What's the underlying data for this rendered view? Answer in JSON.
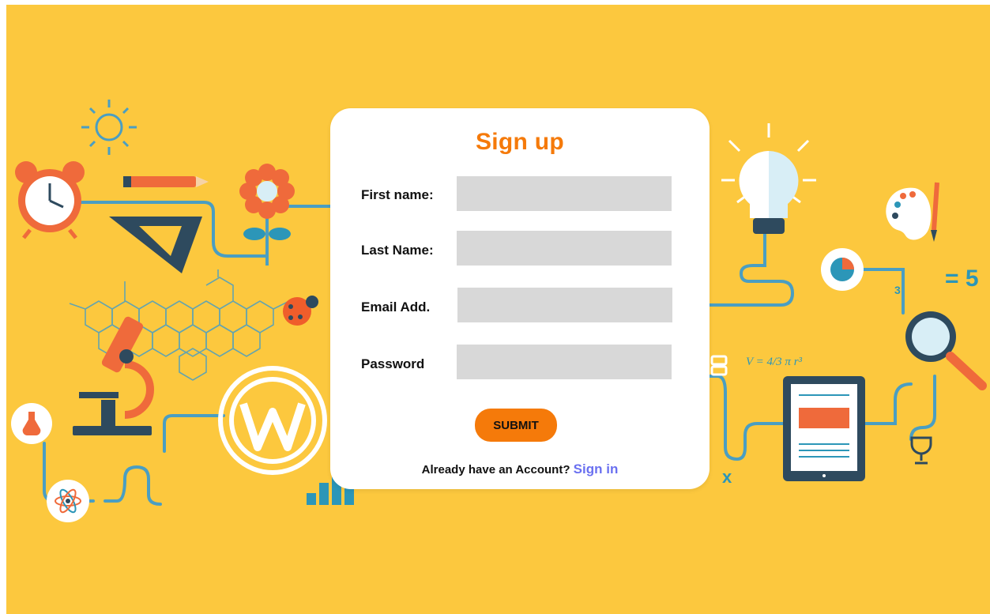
{
  "signup": {
    "title": "Sign up",
    "fields": [
      {
        "label": "First name:",
        "value": "",
        "placeholder": ""
      },
      {
        "label": "Last Name:",
        "value": "",
        "placeholder": ""
      },
      {
        "label": "Email Add.",
        "value": "",
        "placeholder": ""
      },
      {
        "label": "Password",
        "value": "",
        "placeholder": ""
      }
    ],
    "submit_label": "SUBMIT",
    "footer_text": "Already have an Account?",
    "signin_link": "Sign in"
  },
  "background": {
    "equation": "V = 4/3 π r³",
    "equals_five": "= 5",
    "number_three": "3",
    "letter_x": "x"
  },
  "colors": {
    "background": "#fcc83e",
    "card": "#ffffff",
    "accent": "#f57a0a",
    "link": "#6a70f0",
    "input": "#d8d8d8",
    "line": "#4a9ec2"
  }
}
